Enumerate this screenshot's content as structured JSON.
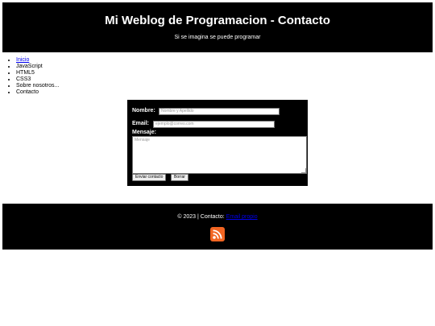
{
  "header": {
    "title": "Mi Weblog de Programacion - Contacto",
    "subtitle": "Si se imagina se puede programar"
  },
  "nav": {
    "items": [
      {
        "label": "Inicio",
        "link": true
      },
      {
        "label": "JavaScript",
        "link": false
      },
      {
        "label": "HTML5",
        "link": false
      },
      {
        "label": "CSS3",
        "link": false
      },
      {
        "label": "Sobre nosotros...",
        "link": false
      },
      {
        "label": "Contacto",
        "link": false
      }
    ]
  },
  "form": {
    "name_label": "Nombre:",
    "name_placeholder": "Nombre y Apellido",
    "email_label": "Email:",
    "email_placeholder": "ejemplo@correo.com",
    "message_label": "Mensaje:",
    "message_placeholder": "Mensaje",
    "submit_label": "Enviar contacto",
    "reset_label": "Borrar"
  },
  "footer": {
    "copyright": "© 2023 | Contacto:",
    "contact_link": "Email propio",
    "rss_icon": "rss-icon",
    "rss_color": "#f26522"
  }
}
